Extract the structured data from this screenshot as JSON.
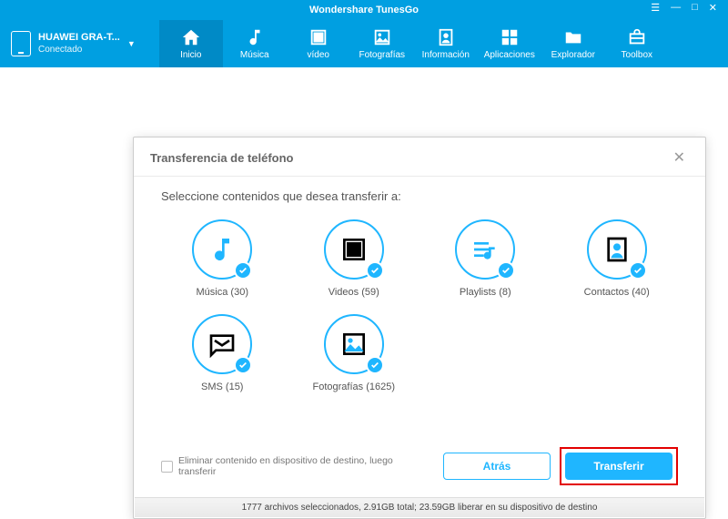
{
  "titlebar": {
    "title": "Wondershare TunesGo"
  },
  "device": {
    "name": "HUAWEI GRA-T...",
    "status": "Conectado"
  },
  "nav": [
    {
      "label": "Inicio",
      "icon": "home",
      "active": true
    },
    {
      "label": "Música",
      "icon": "music",
      "active": false
    },
    {
      "label": "vídeo",
      "icon": "video",
      "active": false
    },
    {
      "label": "Fotografías",
      "icon": "photo",
      "active": false
    },
    {
      "label": "Información",
      "icon": "contacts",
      "active": false
    },
    {
      "label": "Aplicaciones",
      "icon": "apps",
      "active": false
    },
    {
      "label": "Explorador",
      "icon": "folder",
      "active": false
    },
    {
      "label": "Toolbox",
      "icon": "toolbox",
      "active": false
    }
  ],
  "dialog": {
    "title": "Transferencia de teléfono",
    "prompt": "Seleccione contenidos que desea transferir a:",
    "items": [
      {
        "label": "Música (30)",
        "icon": "music",
        "checked": true
      },
      {
        "label": "Videos (59)",
        "icon": "video",
        "checked": true
      },
      {
        "label": "Playlists (8)",
        "icon": "playlist",
        "checked": true
      },
      {
        "label": "Contactos (40)",
        "icon": "contacts",
        "checked": true
      },
      {
        "label": "SMS (15)",
        "icon": "sms",
        "checked": true
      },
      {
        "label": "Fotografías (1625)",
        "icon": "photo",
        "checked": true
      }
    ],
    "erase_label": "Eliminar contenido en dispositivo de destino, luego transferir",
    "back_label": "Atrás",
    "transfer_label": "Transferir",
    "status": "1777 archivos seleccionados, 2.91GB total; 23.59GB liberar en su dispositivo de destino"
  }
}
